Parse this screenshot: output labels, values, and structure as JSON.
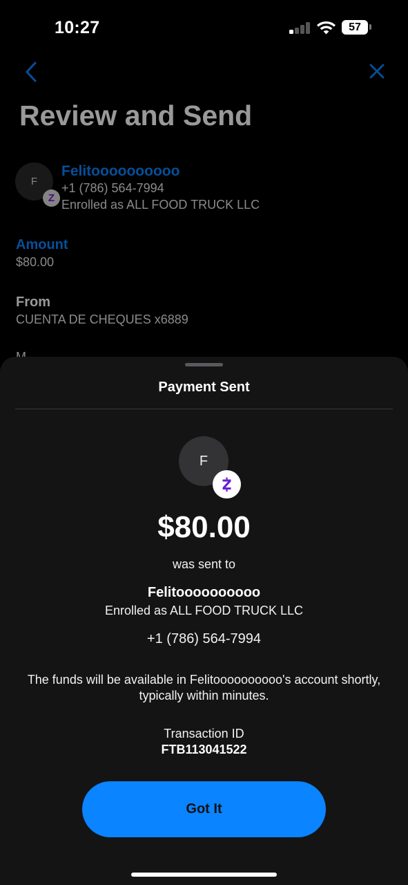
{
  "status_bar": {
    "time": "10:27",
    "battery": "57",
    "signal_icon": "cellular-signal-icon",
    "wifi_icon": "wifi-icon"
  },
  "review": {
    "title": "Review and Send",
    "recipient": {
      "initial": "F",
      "name": "Felitoooooooooo",
      "phone": "+1 (786) 564-7994",
      "enrolled": "Enrolled as ALL FOOD TRUCK LLC"
    },
    "amount_label": "Amount",
    "amount_value": "$80.00",
    "from_label": "From",
    "from_value": "CUENTA DE CHEQUES x6889",
    "partial_label": "M"
  },
  "sheet": {
    "title": "Payment Sent",
    "avatar_initial": "F",
    "amount": "$80.00",
    "sent_to_text": "was sent to",
    "recipient_name": "Felitoooooooooo",
    "recipient_enrolled": "Enrolled as ALL FOOD TRUCK LLC",
    "recipient_phone": "+1 (786) 564-7994",
    "funds_note": "The funds will be available in Felitoooooooooo's account shortly, typically within minutes.",
    "transaction_label": "Transaction ID",
    "transaction_id": "FTB113041522",
    "button_label": "Got It"
  },
  "colors": {
    "accent": "#0a84ff",
    "zelle_purple": "#6d1ed4",
    "sheet_bg": "#141414"
  }
}
